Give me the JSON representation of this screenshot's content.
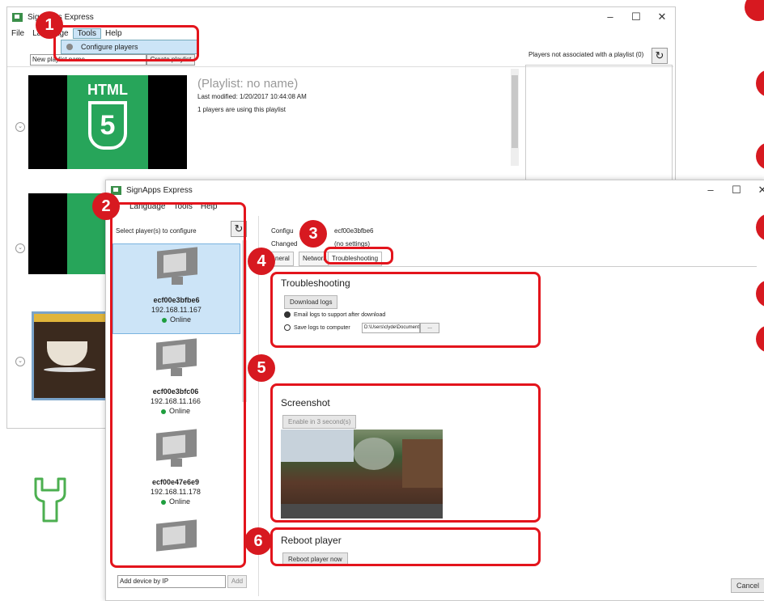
{
  "back_window": {
    "title": "SignApps Express",
    "menu": [
      "File",
      "Language",
      "Tools",
      "Help"
    ],
    "dropdown_item": "Configure players",
    "playlist_name_placeholder": "New playlist name",
    "create_playlist_label": "Create playlist",
    "players_not_associated_label": "Players not associated with a playlist (0)",
    "playlist": {
      "name": "(Playlist: no name)",
      "last_modified": "Last modified: 1/20/2017 10:44:08 AM",
      "players_using": "1 players are using this playlist"
    },
    "tile_text": "HTML",
    "tile_number": "5"
  },
  "front_window": {
    "title": "SignApps Express",
    "menu": [
      "Language",
      "Tools",
      "Help"
    ],
    "select_players_label": "Select player(s) to configure",
    "players": [
      {
        "name": "ecf00e3bfbe6",
        "ip": "192.168.11.167",
        "status": "Online"
      },
      {
        "name": "ecf00e3bfc06",
        "ip": "192.168.11.166",
        "status": "Online"
      },
      {
        "name": "ecf00e47e6e9",
        "ip": "192.168.11.178",
        "status": "Online"
      }
    ],
    "add_device_value": "Add device by IP",
    "add_button": "Add",
    "configure_label": "Configu",
    "configure_value": "ecf00e3bfbe6",
    "changed_label": "Changed",
    "changed_value": "(no settings)",
    "tabs": [
      "neral",
      "Network",
      "Troubleshooting"
    ],
    "troubleshooting": {
      "heading": "Troubleshooting",
      "download_logs": "Download logs",
      "option1": "Email logs to support after download",
      "option2": "Save logs to computer",
      "path_value": "D:\\Users\\clyde\\Documents",
      "browse": "..."
    },
    "screenshot": {
      "heading": "Screenshot",
      "enable_button": "Enable in 3 second(s)"
    },
    "reboot": {
      "heading": "Reboot player",
      "button": "Reboot player now"
    },
    "cancel_button": "Cancel"
  },
  "badges": [
    "1",
    "2",
    "3",
    "4",
    "5",
    "6"
  ],
  "colors": {
    "badge_red": "#d71920",
    "highlight_blue": "#cce4f7",
    "online_green": "#1e9e3e",
    "wrench_green": "#4caf50",
    "html5_green": "#27a55a"
  },
  "icons": [
    "refresh-icon",
    "monitor-icon",
    "wrench-icon",
    "chevron-down-icon",
    "gear-icon",
    "close-icon",
    "minimize-icon",
    "maximize-icon"
  ]
}
